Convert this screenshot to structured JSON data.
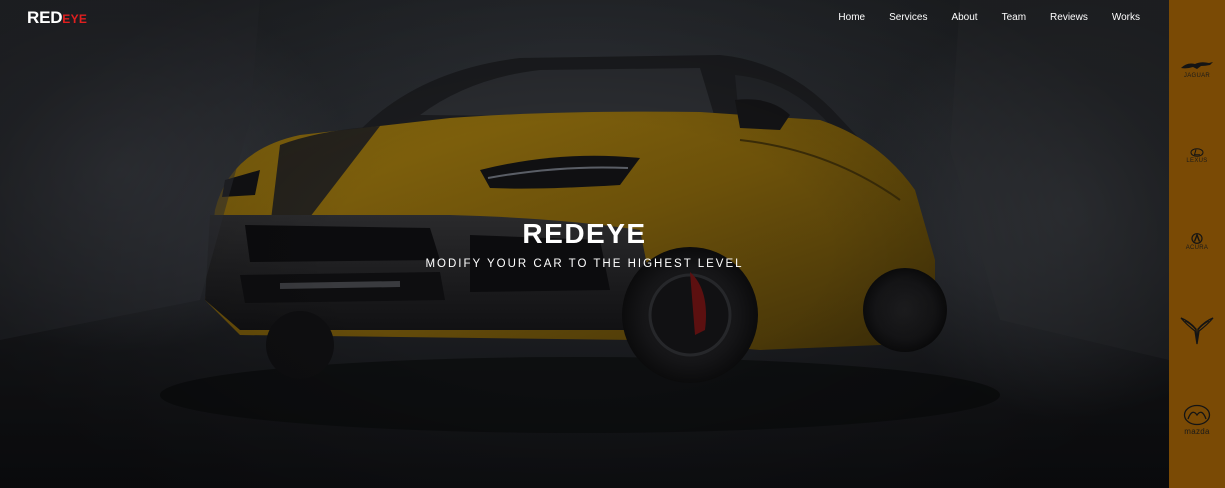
{
  "header": {
    "logo_main": "RED",
    "logo_accent": "EYE",
    "nav": [
      "Home",
      "Services",
      "About",
      "Team",
      "Reviews",
      "Works"
    ]
  },
  "hero": {
    "title": "REDEYE",
    "subtitle": "MODIFY YOUR CAR TO THE HIGHEST LEVEL"
  },
  "brands": [
    {
      "label": "JAGUAR",
      "icon": "jaguar-icon"
    },
    {
      "label": "LEXUS",
      "icon": "lexus-icon"
    },
    {
      "label": "ACURA",
      "icon": "acura-icon"
    },
    {
      "label": "",
      "icon": "corvette-icon"
    },
    {
      "label": "mazda",
      "icon": "mazda-icon"
    }
  ],
  "colors": {
    "accent_red": "#e01f1f",
    "brand_bar": "#7a4a05",
    "car_yellow": "#b8860b"
  }
}
